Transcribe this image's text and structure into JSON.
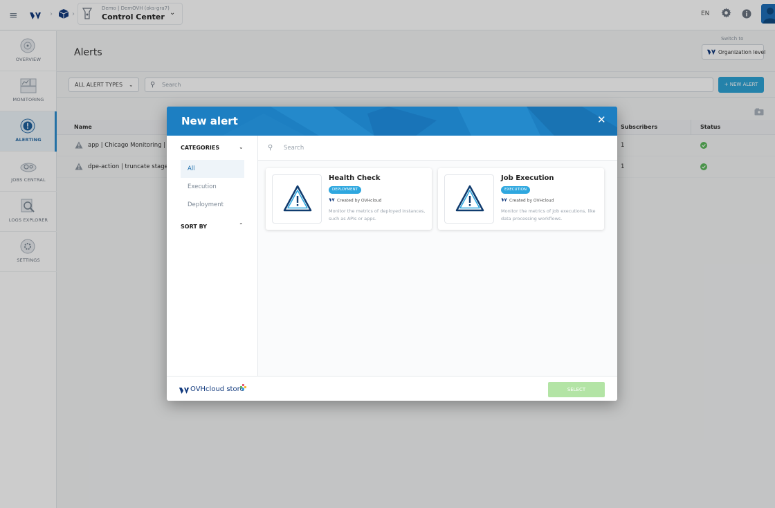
{
  "topbar": {
    "project_sub": "Demo | DemOVH (oks-gra7)",
    "project_title": "Control Center",
    "language": "EN"
  },
  "sidebar": {
    "items": [
      {
        "label": "OVERVIEW",
        "icon": "overview-icon"
      },
      {
        "label": "MONITORING",
        "icon": "monitoring-icon"
      },
      {
        "label": "ALERTING",
        "icon": "alerting-icon",
        "active": true
      },
      {
        "label": "JOBS CENTRAL",
        "icon": "jobs-central-icon"
      },
      {
        "label": "LOGS EXPLORER",
        "icon": "logs-explorer-icon"
      },
      {
        "label": "SETTINGS",
        "icon": "settings-icon"
      }
    ]
  },
  "page": {
    "title": "Alerts",
    "switch_to": "Switch to",
    "org_level": "Organization level",
    "alert_type_filter": "ALL ALERT TYPES",
    "search_placeholder": "Search",
    "new_alert_label": "+ NEW ALERT"
  },
  "table": {
    "columns": [
      "Name",
      "Subscribers",
      "Status"
    ],
    "rows": [
      {
        "name": "app | Chicago Monitoring | sta",
        "subscribers": "1",
        "status": "ok"
      },
      {
        "name": "dpe-action | truncate stage ta",
        "subscribers": "1",
        "status": "ok"
      }
    ]
  },
  "modal": {
    "title": "New alert",
    "categories_label": "CATEGORIES",
    "categories": [
      "All",
      "Execution",
      "Deployment"
    ],
    "active_category": "All",
    "sort_by_label": "SORT BY",
    "search_placeholder": "Search",
    "cards": [
      {
        "title": "Health Check",
        "badge": "DEPLOYMENT",
        "created_by": "Created by OVHcloud",
        "description": "Monitor the metrics of deployed instances, such as APIs or apps."
      },
      {
        "title": "Job Execution",
        "badge": "EXECUTION",
        "created_by": "Created by OVHcloud",
        "description": "Monitor the metrics of job executions, like data processing workflows."
      }
    ],
    "store_label": "OVHcloud store",
    "select_label": "SELECT"
  },
  "colors": {
    "accent": "#2ea3d5",
    "brand_dark": "#123a7e",
    "status_ok": "#5cb85c",
    "select_disabled": "#b3e4a5"
  }
}
